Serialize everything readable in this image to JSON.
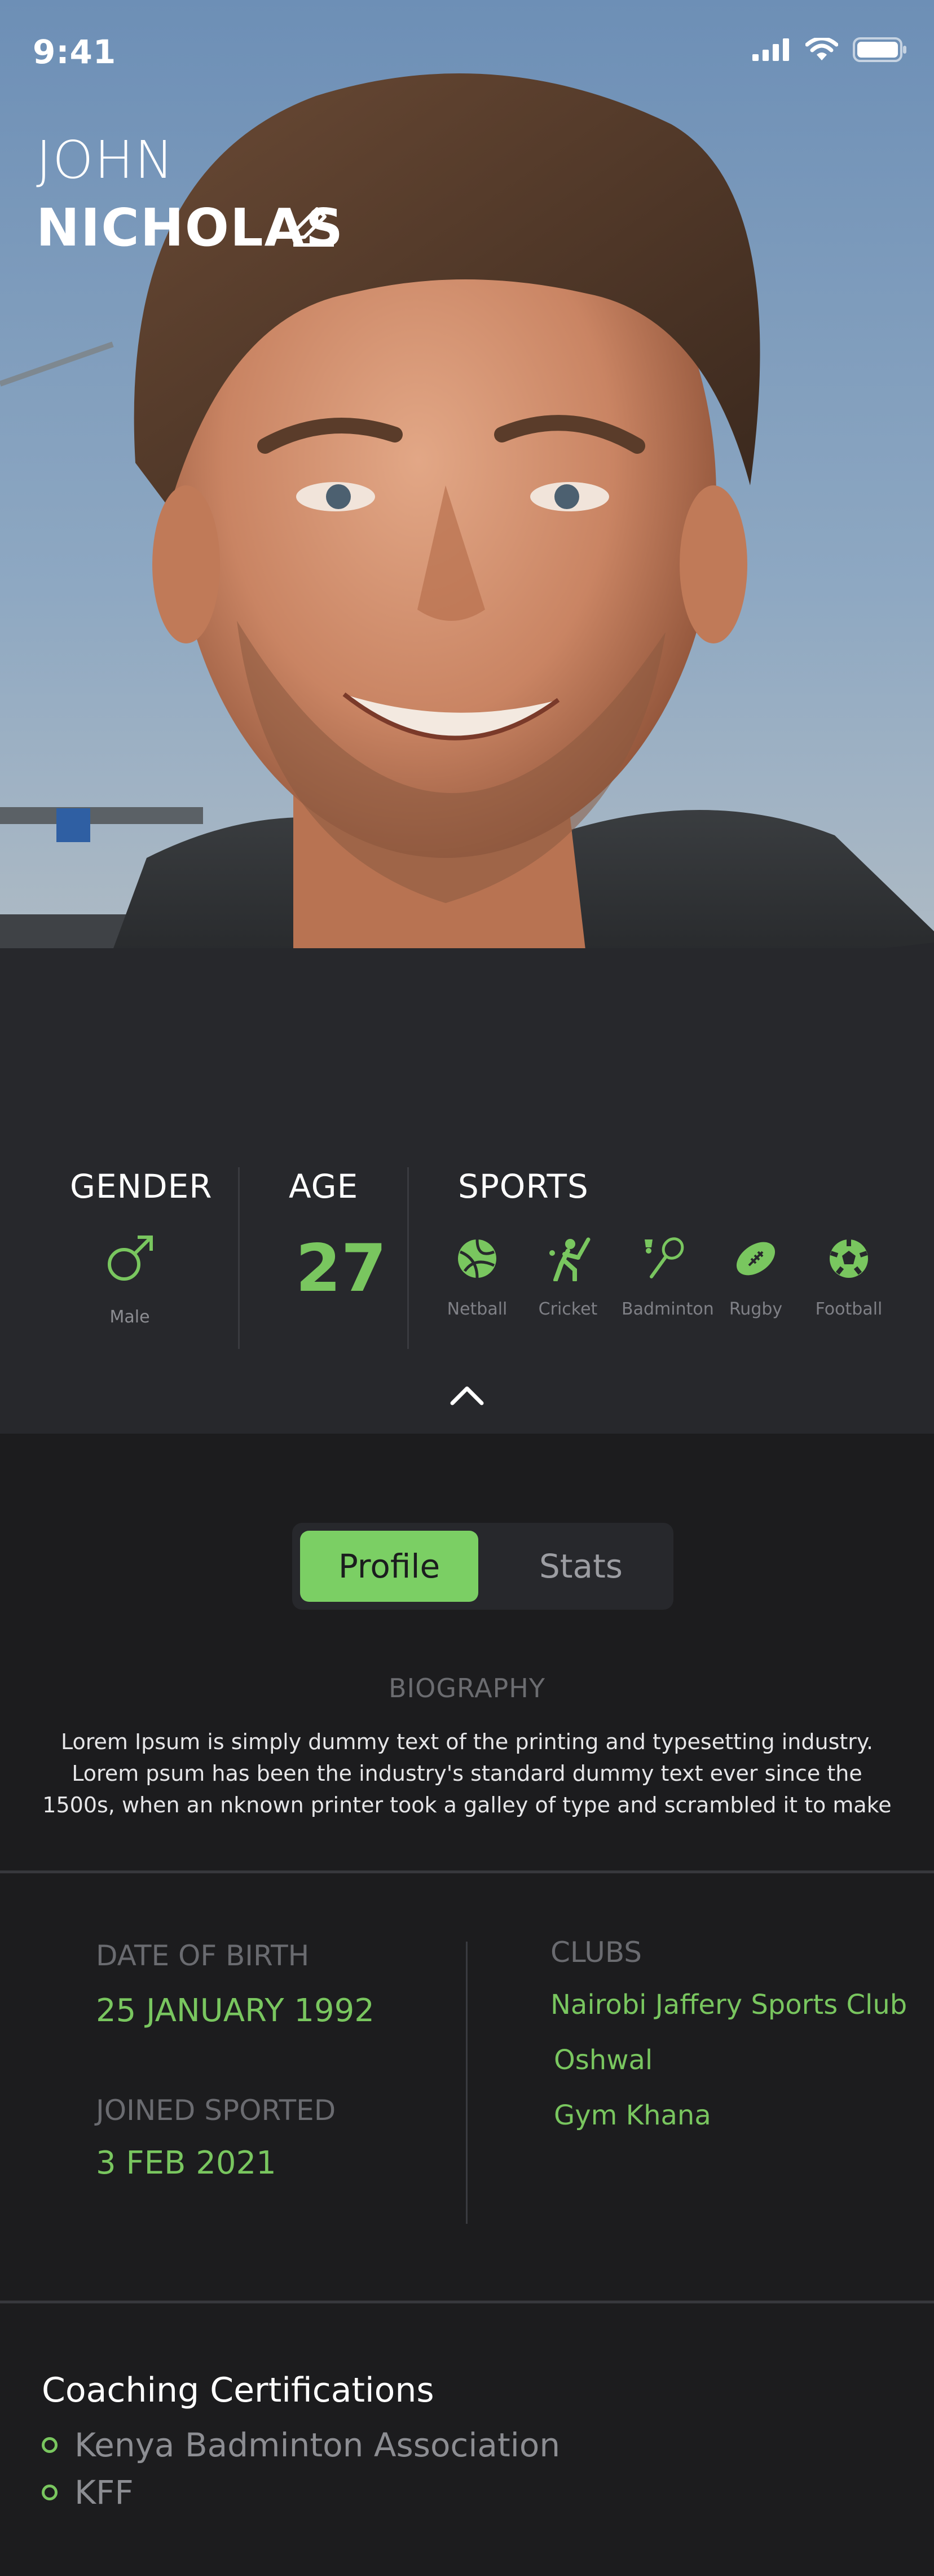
{
  "status_bar": {
    "time": "9:41",
    "icons": [
      "signal-icon",
      "wifi-icon",
      "battery-icon"
    ]
  },
  "profile": {
    "first_name": "JOHN",
    "last_name": "NICHOLAS"
  },
  "info": {
    "gender_title": "GENDER",
    "gender_value": "Male",
    "age_title": "AGE",
    "age_value": "27",
    "sports_title": "SPORTS",
    "sports": [
      {
        "label": "Netball",
        "icon": "netball-icon"
      },
      {
        "label": "Cricket",
        "icon": "cricket-icon"
      },
      {
        "label": "Badminton",
        "icon": "badminton-icon"
      },
      {
        "label": "Rugby",
        "icon": "rugby-icon"
      },
      {
        "label": "Football",
        "icon": "football-icon"
      }
    ]
  },
  "tabs": {
    "profile": "Profile",
    "stats": "Stats",
    "active": "Profile"
  },
  "biography": {
    "title": "BIOGRAPHY",
    "lines": [
      "Lorem Ipsum is simply dummy text of the printing and typesetting industry.",
      "Lorem psum  has been the  industry's standard dummy text ever since the",
      "1500s, when an  nknown printer took a galley of type and  scrambled it to make"
    ]
  },
  "details": {
    "dob_label": "DATE OF BIRTH",
    "dob_value": "25 JANUARY 1992",
    "joined_label": "JOINED SPORTED",
    "joined_value": "3 FEB 2021",
    "clubs_label": "CLUBS",
    "clubs": [
      "Nairobi Jaffery Sports Club",
      "Oshwal",
      "Gym Khana"
    ]
  },
  "certifications": {
    "title": "Coaching Certifications",
    "items": [
      "Kenya Badminton Association",
      "KFF"
    ]
  },
  "colors": {
    "accent": "#7bcf64",
    "panel": "#27282c",
    "background": "#1c1c1e"
  }
}
